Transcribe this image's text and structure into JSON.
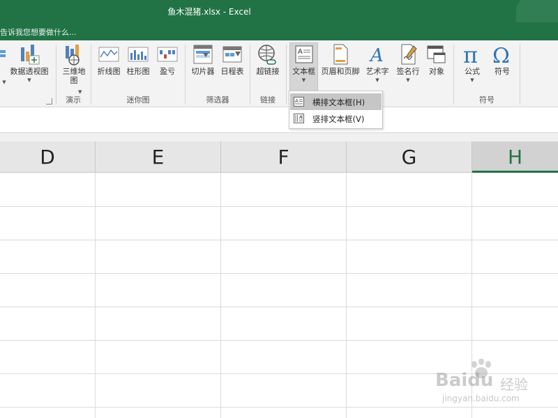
{
  "window": {
    "title": "鱼木混猪.xlsx - Excel"
  },
  "tellme": {
    "text": "告诉我您想要做什么..."
  },
  "ribbon": {
    "groups": {
      "tables_label": "",
      "tours": {
        "label": "演示",
        "buttons": [
          {
            "label": "三维地\n图",
            "icon": "3d-map-icon"
          }
        ]
      },
      "sparklines": {
        "label": "迷你图",
        "buttons": [
          {
            "label": "折线图",
            "icon": "sparkline-line-icon"
          },
          {
            "label": "柱形图",
            "icon": "sparkline-column-icon"
          },
          {
            "label": "盈亏",
            "icon": "sparkline-winloss-icon"
          }
        ]
      },
      "filters": {
        "label": "筛选器",
        "buttons": [
          {
            "label": "切片器",
            "icon": "slicer-icon"
          },
          {
            "label": "日程表",
            "icon": "timeline-icon"
          }
        ]
      },
      "links": {
        "label": "链接",
        "buttons": [
          {
            "label": "超链接",
            "icon": "hyperlink-icon"
          }
        ]
      },
      "text": {
        "label": "",
        "buttons": [
          {
            "label": "文本框",
            "icon": "textbox-icon"
          },
          {
            "label": "页眉和页脚",
            "icon": "header-footer-icon"
          },
          {
            "label": "艺术字",
            "icon": "wordart-icon"
          },
          {
            "label": "签名行",
            "icon": "signature-line-icon"
          },
          {
            "label": "对象",
            "icon": "object-icon"
          }
        ]
      },
      "symbols": {
        "label": "符号",
        "buttons": [
          {
            "label": "公式",
            "icon": "equation-icon"
          },
          {
            "label": "符号",
            "icon": "symbol-icon"
          }
        ]
      }
    },
    "pivotchart_label": "数据透视图"
  },
  "dropdown": {
    "items": [
      {
        "label": "横排文本框(H)",
        "icon": "horizontal-textbox-icon",
        "highlighted": true
      },
      {
        "label": "竖排文本框(V)",
        "icon": "vertical-textbox-icon",
        "highlighted": false
      }
    ]
  },
  "grid": {
    "columns": [
      "D",
      "E",
      "F",
      "G",
      "H"
    ],
    "selected_column": "H"
  },
  "watermark": {
    "brand": "Bai",
    "brand2": "du",
    "sub": "经验",
    "url": "jingyan.baidu.com"
  },
  "colors": {
    "accent": "#217346",
    "ribbon_bg": "#f3f3f3",
    "menu_highlight": "#c6c6c6"
  }
}
